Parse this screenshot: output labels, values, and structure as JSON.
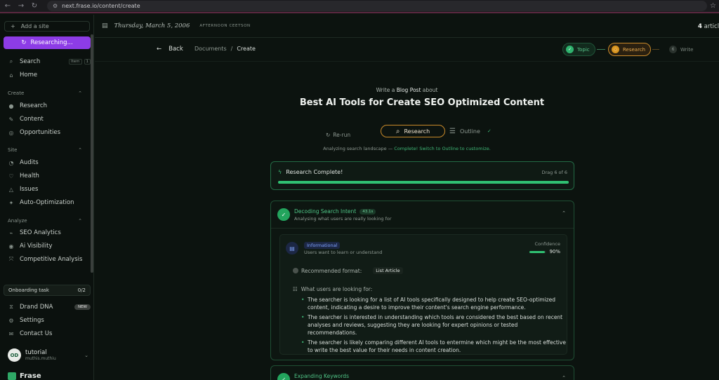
{
  "browser": {
    "url": "next.frase.io/content/create"
  },
  "sidebar": {
    "add_site": "Add a site",
    "researching": "Researching...",
    "search": {
      "label": "Search",
      "keys": [
        "Item",
        "1"
      ]
    },
    "home": "Home",
    "sections": {
      "create": "Create",
      "site": "Site",
      "analyze": "Analyze"
    },
    "create_items": [
      "Research",
      "Content",
      "Opportunities"
    ],
    "site_items": [
      "Audits",
      "Health",
      "Issues",
      "Auto-Optimization"
    ],
    "analyze_items": [
      "SEO Analytics",
      "Ai Visibility",
      "Competitive Analysis"
    ],
    "onboarding": {
      "label": "Onboarding task",
      "count": "0/2"
    },
    "bottom_items": {
      "brand_dna": "Drand DNA",
      "new_badge": "NEW",
      "settings": "Settings",
      "contact": "Contact Us"
    },
    "user": {
      "name": "tutorial",
      "email": "muthis.muthiu",
      "initials": "OD"
    },
    "brand": "Frase"
  },
  "topbar": {
    "date": "Thursday, March 5, 2006",
    "subtitle": "AFTERNOON CEETSON",
    "articles_count": "4",
    "articles_label": "article"
  },
  "nav": {
    "back": "Back",
    "breadcrumb": [
      "Documents",
      "Create"
    ],
    "steps": {
      "topic": "Topic",
      "research": "Research",
      "write": "Write",
      "write_num": "6"
    }
  },
  "heading": {
    "write_prefix": "Write a",
    "content_type": "Blog Post",
    "write_suffix": "about",
    "title": "Best AI Tools for Create SEO Optimized Content"
  },
  "modes": {
    "rerun": "Re-run",
    "research": "Research",
    "outline": "Outline",
    "hint_prefix": "Analyzing search landscape —",
    "hint_link": "Complete! Switch to Outline to customize."
  },
  "complete_card": {
    "title": "Research Complete!",
    "drag": "Drag 6 of 6",
    "progress": 1.0
  },
  "intent_card": {
    "title": "Decoding Search Intent",
    "badge": "43.1s",
    "subtitle": "Analysing what users are really looking for",
    "intent_type": "Informational",
    "intent_desc": "Users want to learn or understand",
    "confidence_label": "Confidence",
    "confidence_value": "90%",
    "confidence": 0.9,
    "rec_label": "Recommended format:",
    "rec_value": "List Article",
    "looking_label": "What users are looking for:",
    "points": [
      "The searcher is looking for a list of AI tools specifically designed to help create SEO-optimized content, indicating a desire to improve their content's search engine performance.",
      "The searcher is interested in understanding which tools are considered the best based on recent analyses and reviews, suggesting they are looking for expert opinions or tested recommendations.",
      "The searcher is likely comparing different AI tools to entermine which might be the most effective to write the best value for their needs in content creation."
    ]
  },
  "keywords_card": {
    "title": "Expanding Keywords"
  },
  "colors": {
    "accent_purple": "#8d3ce6",
    "green": "#30c172",
    "amber": "#d9951f"
  },
  "icons": [
    "search-icon",
    "home-icon",
    "refresh-icon",
    "bolt-icon",
    "check-icon",
    "document-icon",
    "list-icon",
    "chevron-up-icon",
    "arrow-left-icon"
  ]
}
